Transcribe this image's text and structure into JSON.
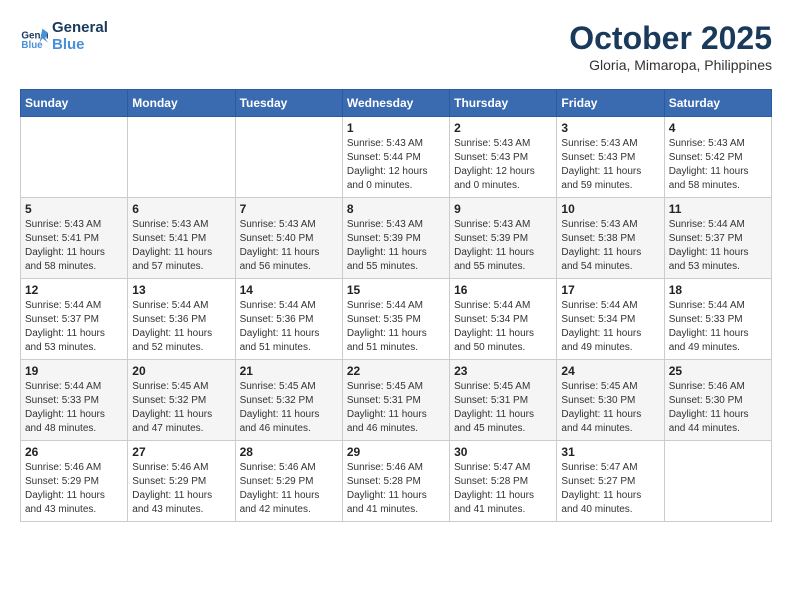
{
  "header": {
    "logo_line1": "General",
    "logo_line2": "Blue",
    "month": "October 2025",
    "location": "Gloria, Mimaropa, Philippines"
  },
  "weekdays": [
    "Sunday",
    "Monday",
    "Tuesday",
    "Wednesday",
    "Thursday",
    "Friday",
    "Saturday"
  ],
  "weeks": [
    [
      {
        "day": "",
        "info": ""
      },
      {
        "day": "",
        "info": ""
      },
      {
        "day": "",
        "info": ""
      },
      {
        "day": "1",
        "info": "Sunrise: 5:43 AM\nSunset: 5:44 PM\nDaylight: 12 hours\nand 0 minutes."
      },
      {
        "day": "2",
        "info": "Sunrise: 5:43 AM\nSunset: 5:43 PM\nDaylight: 12 hours\nand 0 minutes."
      },
      {
        "day": "3",
        "info": "Sunrise: 5:43 AM\nSunset: 5:43 PM\nDaylight: 11 hours\nand 59 minutes."
      },
      {
        "day": "4",
        "info": "Sunrise: 5:43 AM\nSunset: 5:42 PM\nDaylight: 11 hours\nand 58 minutes."
      }
    ],
    [
      {
        "day": "5",
        "info": "Sunrise: 5:43 AM\nSunset: 5:41 PM\nDaylight: 11 hours\nand 58 minutes."
      },
      {
        "day": "6",
        "info": "Sunrise: 5:43 AM\nSunset: 5:41 PM\nDaylight: 11 hours\nand 57 minutes."
      },
      {
        "day": "7",
        "info": "Sunrise: 5:43 AM\nSunset: 5:40 PM\nDaylight: 11 hours\nand 56 minutes."
      },
      {
        "day": "8",
        "info": "Sunrise: 5:43 AM\nSunset: 5:39 PM\nDaylight: 11 hours\nand 55 minutes."
      },
      {
        "day": "9",
        "info": "Sunrise: 5:43 AM\nSunset: 5:39 PM\nDaylight: 11 hours\nand 55 minutes."
      },
      {
        "day": "10",
        "info": "Sunrise: 5:43 AM\nSunset: 5:38 PM\nDaylight: 11 hours\nand 54 minutes."
      },
      {
        "day": "11",
        "info": "Sunrise: 5:44 AM\nSunset: 5:37 PM\nDaylight: 11 hours\nand 53 minutes."
      }
    ],
    [
      {
        "day": "12",
        "info": "Sunrise: 5:44 AM\nSunset: 5:37 PM\nDaylight: 11 hours\nand 53 minutes."
      },
      {
        "day": "13",
        "info": "Sunrise: 5:44 AM\nSunset: 5:36 PM\nDaylight: 11 hours\nand 52 minutes."
      },
      {
        "day": "14",
        "info": "Sunrise: 5:44 AM\nSunset: 5:36 PM\nDaylight: 11 hours\nand 51 minutes."
      },
      {
        "day": "15",
        "info": "Sunrise: 5:44 AM\nSunset: 5:35 PM\nDaylight: 11 hours\nand 51 minutes."
      },
      {
        "day": "16",
        "info": "Sunrise: 5:44 AM\nSunset: 5:34 PM\nDaylight: 11 hours\nand 50 minutes."
      },
      {
        "day": "17",
        "info": "Sunrise: 5:44 AM\nSunset: 5:34 PM\nDaylight: 11 hours\nand 49 minutes."
      },
      {
        "day": "18",
        "info": "Sunrise: 5:44 AM\nSunset: 5:33 PM\nDaylight: 11 hours\nand 49 minutes."
      }
    ],
    [
      {
        "day": "19",
        "info": "Sunrise: 5:44 AM\nSunset: 5:33 PM\nDaylight: 11 hours\nand 48 minutes."
      },
      {
        "day": "20",
        "info": "Sunrise: 5:45 AM\nSunset: 5:32 PM\nDaylight: 11 hours\nand 47 minutes."
      },
      {
        "day": "21",
        "info": "Sunrise: 5:45 AM\nSunset: 5:32 PM\nDaylight: 11 hours\nand 46 minutes."
      },
      {
        "day": "22",
        "info": "Sunrise: 5:45 AM\nSunset: 5:31 PM\nDaylight: 11 hours\nand 46 minutes."
      },
      {
        "day": "23",
        "info": "Sunrise: 5:45 AM\nSunset: 5:31 PM\nDaylight: 11 hours\nand 45 minutes."
      },
      {
        "day": "24",
        "info": "Sunrise: 5:45 AM\nSunset: 5:30 PM\nDaylight: 11 hours\nand 44 minutes."
      },
      {
        "day": "25",
        "info": "Sunrise: 5:46 AM\nSunset: 5:30 PM\nDaylight: 11 hours\nand 44 minutes."
      }
    ],
    [
      {
        "day": "26",
        "info": "Sunrise: 5:46 AM\nSunset: 5:29 PM\nDaylight: 11 hours\nand 43 minutes."
      },
      {
        "day": "27",
        "info": "Sunrise: 5:46 AM\nSunset: 5:29 PM\nDaylight: 11 hours\nand 43 minutes."
      },
      {
        "day": "28",
        "info": "Sunrise: 5:46 AM\nSunset: 5:29 PM\nDaylight: 11 hours\nand 42 minutes."
      },
      {
        "day": "29",
        "info": "Sunrise: 5:46 AM\nSunset: 5:28 PM\nDaylight: 11 hours\nand 41 minutes."
      },
      {
        "day": "30",
        "info": "Sunrise: 5:47 AM\nSunset: 5:28 PM\nDaylight: 11 hours\nand 41 minutes."
      },
      {
        "day": "31",
        "info": "Sunrise: 5:47 AM\nSunset: 5:27 PM\nDaylight: 11 hours\nand 40 minutes."
      },
      {
        "day": "",
        "info": ""
      }
    ]
  ]
}
